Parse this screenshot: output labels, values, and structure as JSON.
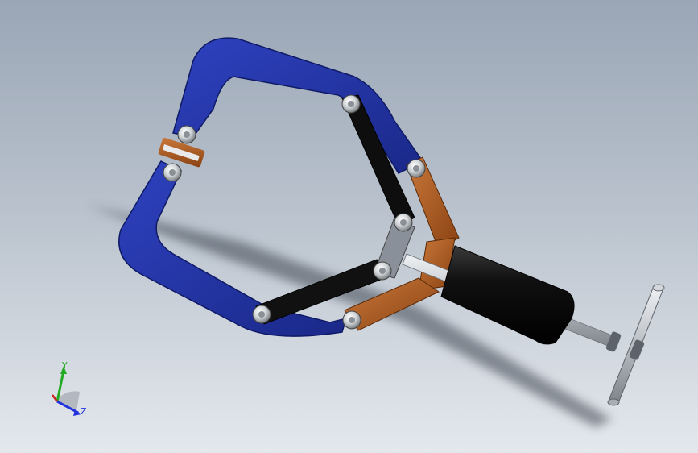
{
  "scene": {
    "background_top": "#9aa6b6",
    "background_bottom": "#e4e8ed",
    "parts": {
      "frame_color": "#1f2f9e",
      "frame_highlight": "#3045c4",
      "link_color": "#111111",
      "link_highlight": "#3a3a3a",
      "bracket_color": "#a3531a",
      "bracket_highlight": "#c9783a",
      "cylinder_color": "#0d0d0d",
      "rod_color": "#c9cdd2",
      "bolt_color": "#d9dcdf"
    }
  },
  "triad": {
    "y_label": "Y",
    "z_label": "Z",
    "x_label": "X",
    "y_color": "#22aa22",
    "z_color": "#2233dd",
    "x_color": "#cc2222"
  }
}
